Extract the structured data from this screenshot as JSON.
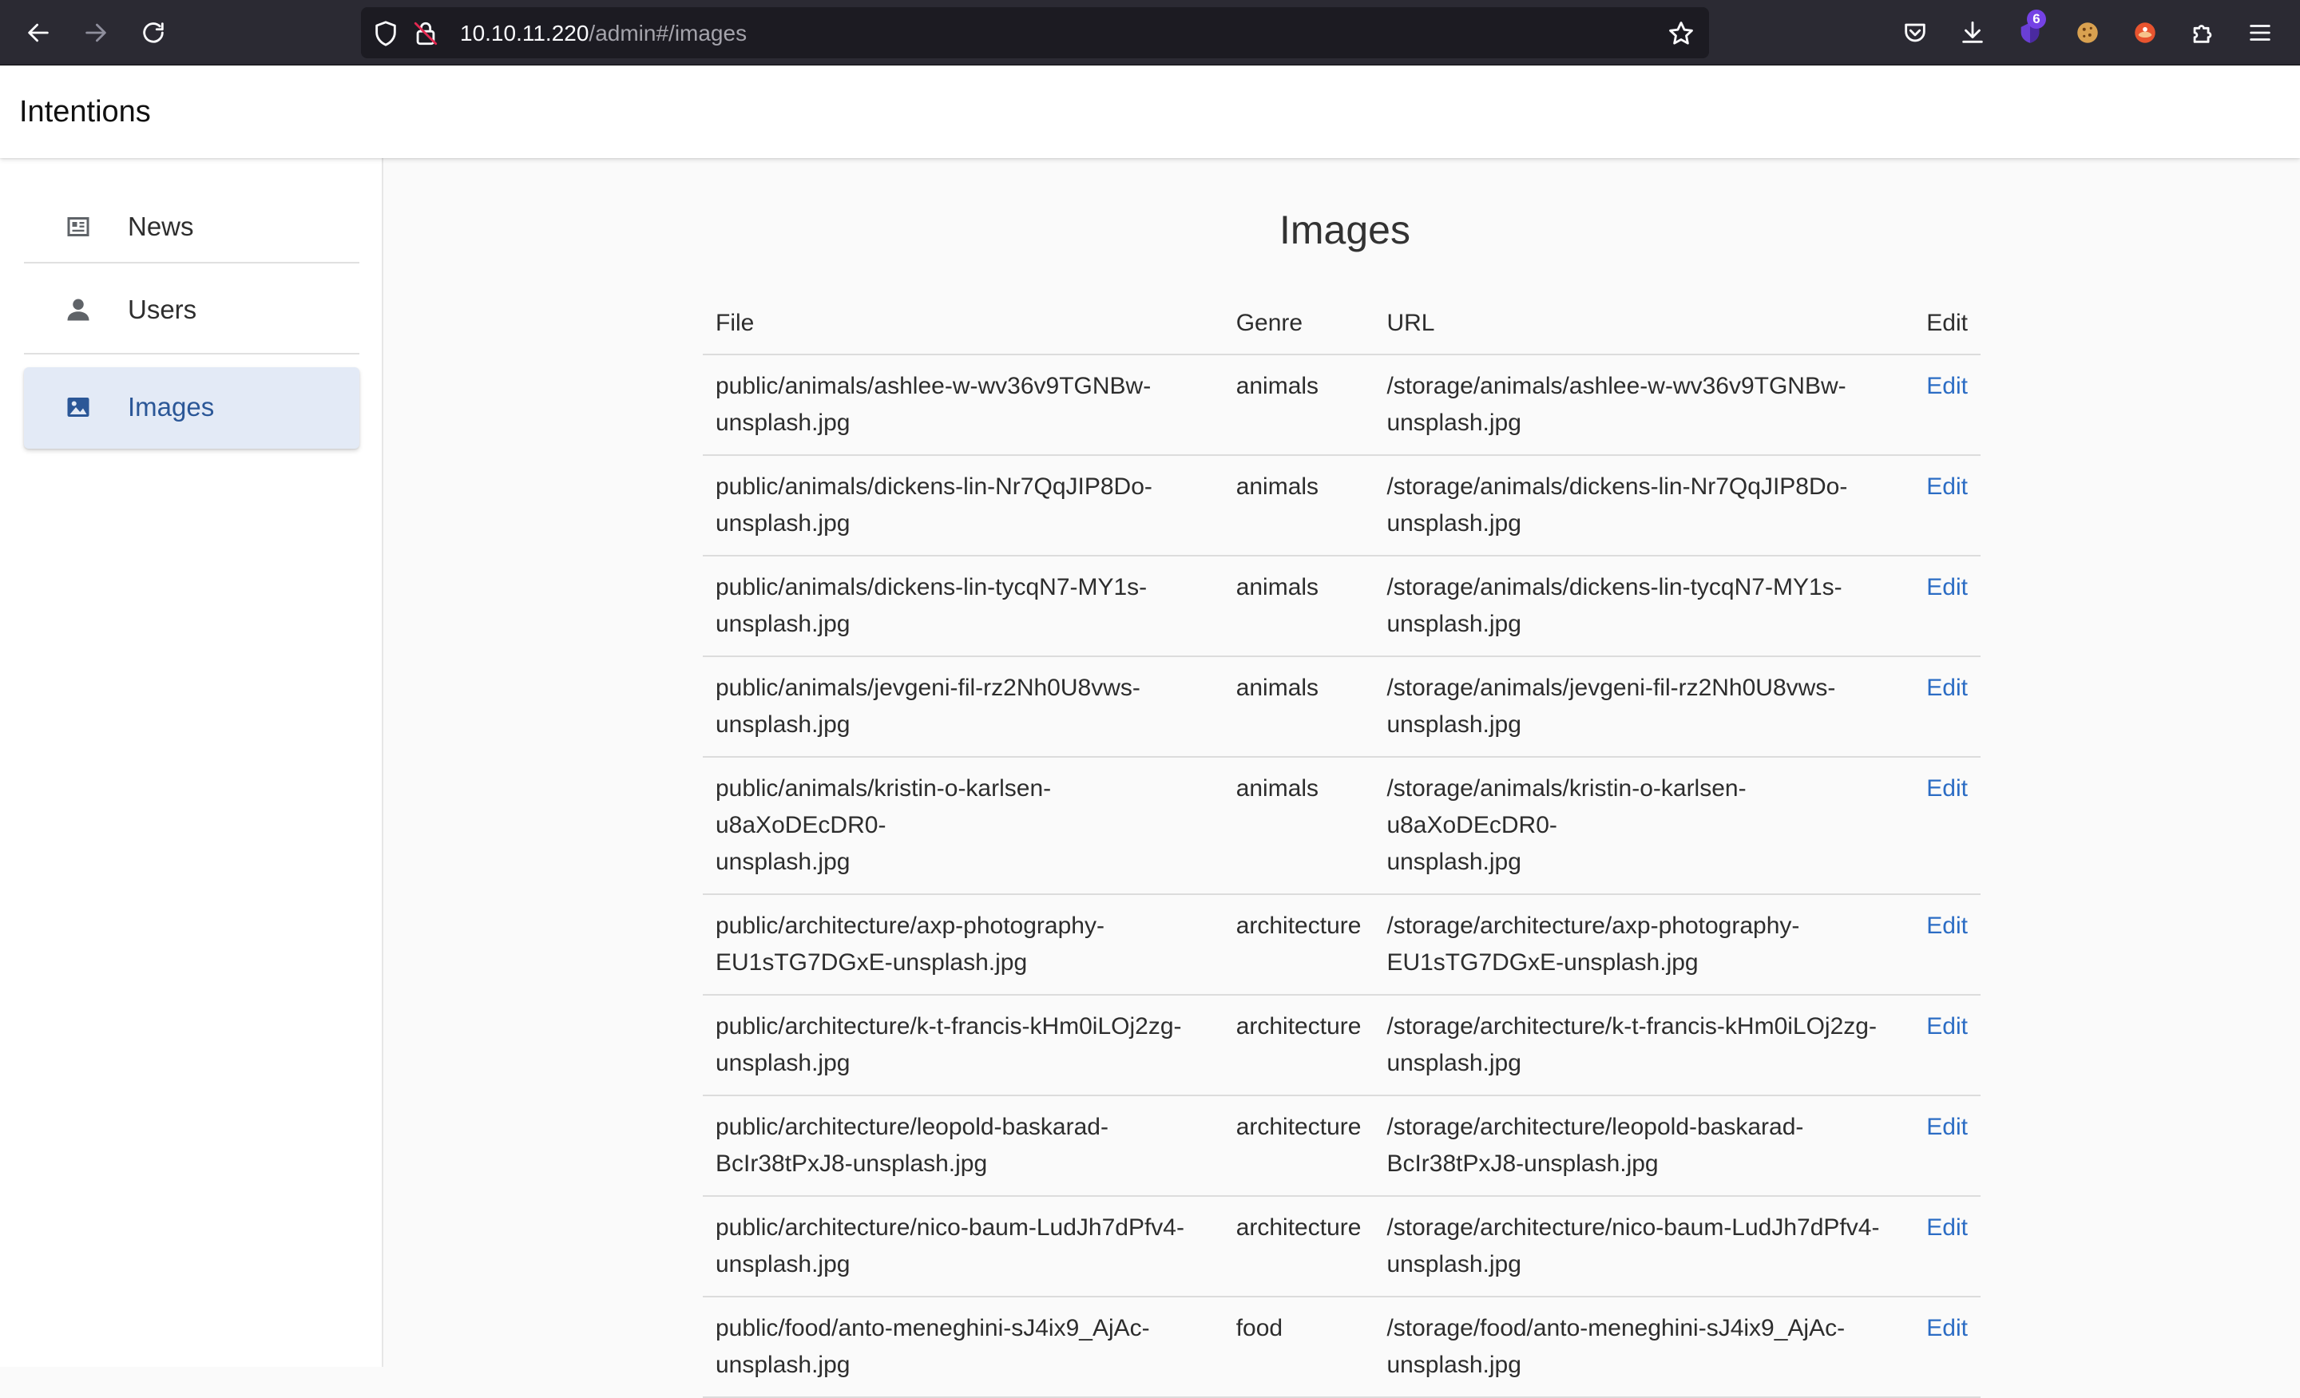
{
  "browser": {
    "url_host": "10.10.11.220",
    "url_path": "/admin#/images",
    "extension_badge": "6"
  },
  "app": {
    "title": "Intentions"
  },
  "sidebar": {
    "items": [
      {
        "label": "News",
        "icon": "newspaper-icon"
      },
      {
        "label": "Users",
        "icon": "user-icon"
      },
      {
        "label": "Images",
        "icon": "image-icon",
        "active": true
      }
    ]
  },
  "main": {
    "title": "Images",
    "columns": [
      "File",
      "Genre",
      "URL",
      "Edit"
    ],
    "rows": [
      {
        "file": [
          "public/animals/ashlee-w-wv36v9TGNBw-",
          "unsplash.jpg"
        ],
        "genre": "animals",
        "url": [
          "/storage/animals/ashlee-w-wv36v9TGNBw-",
          "unsplash.jpg"
        ],
        "edit": "Edit"
      },
      {
        "file": [
          "public/animals/dickens-lin-Nr7QqJIP8Do-",
          "unsplash.jpg"
        ],
        "genre": "animals",
        "url": [
          "/storage/animals/dickens-lin-Nr7QqJIP8Do-",
          "unsplash.jpg"
        ],
        "edit": "Edit"
      },
      {
        "file": [
          "public/animals/dickens-lin-tycqN7-MY1s-",
          "unsplash.jpg"
        ],
        "genre": "animals",
        "url": [
          "/storage/animals/dickens-lin-tycqN7-MY1s-",
          "unsplash.jpg"
        ],
        "edit": "Edit"
      },
      {
        "file": [
          "public/animals/jevgeni-fil-rz2Nh0U8vws-",
          "unsplash.jpg"
        ],
        "genre": "animals",
        "url": [
          "/storage/animals/jevgeni-fil-rz2Nh0U8vws-",
          "unsplash.jpg"
        ],
        "edit": "Edit"
      },
      {
        "file": [
          "public/animals/kristin-o-karlsen-u8aXoDEcDR0-",
          "unsplash.jpg"
        ],
        "genre": "animals",
        "url": [
          "/storage/animals/kristin-o-karlsen-u8aXoDEcDR0-",
          "unsplash.jpg"
        ],
        "edit": "Edit"
      },
      {
        "file": [
          "public/architecture/axp-photography-",
          "EU1sTG7DGxE-unsplash.jpg"
        ],
        "genre": "architecture",
        "url": [
          "/storage/architecture/axp-photography-",
          "EU1sTG7DGxE-unsplash.jpg"
        ],
        "edit": "Edit"
      },
      {
        "file": [
          "public/architecture/k-t-francis-kHm0iLOj2zg-",
          "unsplash.jpg"
        ],
        "genre": "architecture",
        "url": [
          "/storage/architecture/k-t-francis-kHm0iLOj2zg-",
          "unsplash.jpg"
        ],
        "edit": "Edit"
      },
      {
        "file": [
          "public/architecture/leopold-baskarad-",
          "BcIr38tPxJ8-unsplash.jpg"
        ],
        "genre": "architecture",
        "url": [
          "/storage/architecture/leopold-baskarad-",
          "BcIr38tPxJ8-unsplash.jpg"
        ],
        "edit": "Edit"
      },
      {
        "file": [
          "public/architecture/nico-baum-LudJh7dPfv4-",
          "unsplash.jpg"
        ],
        "genre": "architecture",
        "url": [
          "/storage/architecture/nico-baum-LudJh7dPfv4-",
          "unsplash.jpg"
        ],
        "edit": "Edit"
      },
      {
        "file": [
          "public/food/anto-meneghini-sJ4ix9_AjAc-",
          "unsplash.jpg"
        ],
        "genre": "food",
        "url": [
          "/storage/food/anto-meneghini-sJ4ix9_AjAc-",
          "unsplash.jpg"
        ],
        "edit": "Edit"
      }
    ]
  },
  "colors": {
    "chrome_bg": "#2b2a33",
    "urlbar_bg": "#1c1b22",
    "accent_link": "#2b6cc4",
    "sidebar_active_bg": "#e3eaf6",
    "sidebar_active_text": "#2b5797",
    "badge": "#7542e5"
  }
}
